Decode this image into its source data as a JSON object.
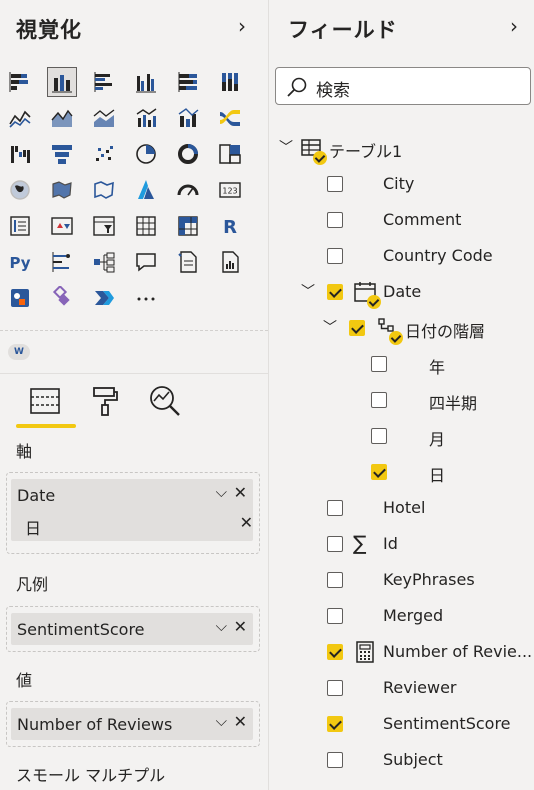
{
  "viz_pane": {
    "title": "視覚化",
    "gallery": [
      "stacked-bar-icon",
      "stacked-column-icon",
      "clustered-bar-icon",
      "clustered-column-icon",
      "100-stacked-bar-icon",
      "100-stacked-column-icon",
      "line-chart-icon",
      "area-chart-icon",
      "stacked-area-icon",
      "line-clustered-column-icon",
      "line-stacked-column-icon",
      "ribbon-chart-icon",
      "waterfall-icon",
      "funnel-icon",
      "scatter-icon",
      "pie-chart-icon",
      "donut-chart-icon",
      "treemap-icon",
      "map-icon",
      "filled-map-icon",
      "shape-map-icon",
      "azure-map-icon",
      "gauge-icon",
      "card-icon",
      "multi-row-card-icon",
      "kpi-icon",
      "slicer-icon",
      "table-icon",
      "matrix-icon",
      "r-visual-icon",
      "python-visual-icon",
      "key-influencers-icon",
      "decomposition-tree-icon",
      "qa-icon",
      "smart-narrative-icon",
      "paginated-report-icon",
      "power-apps-icon",
      "custom-visual-icon",
      "power-automate-icon",
      "more-visuals-icon"
    ],
    "selected_visual": "stacked-column-icon",
    "custom_badge": "W",
    "tabs": [
      "fields-tab-icon",
      "format-tab-icon",
      "analytics-tab-icon"
    ],
    "wells": {
      "axis_label": "軸",
      "axis_field": "Date",
      "axis_sub": "日",
      "legend_label": "凡例",
      "legend_field": "SentimentScore",
      "values_label": "値",
      "values_field": "Number of Reviews",
      "small_multiples_label": "スモール マルチプル"
    },
    "chevron": "›",
    "remove_glyph": "✕",
    "dropdown_glyph": "⌵"
  },
  "fields_pane": {
    "title": "フィールド",
    "search_placeholder": "検索",
    "table_name": "テーブル1",
    "date_field": "Date",
    "hierarchy_name": "日付の階層",
    "hierarchy_levels": [
      {
        "label": "年",
        "checked": false
      },
      {
        "label": "四半期",
        "checked": false
      },
      {
        "label": "月",
        "checked": false
      },
      {
        "label": "日",
        "checked": true
      }
    ],
    "fields_before": [
      {
        "label": "City",
        "checked": false
      },
      {
        "label": "Comment",
        "checked": false
      },
      {
        "label": "Country Code",
        "checked": false
      }
    ],
    "fields_after": [
      {
        "label": "Hotel",
        "checked": false,
        "icon": ""
      },
      {
        "label": "Id",
        "checked": false,
        "icon": "sigma-icon"
      },
      {
        "label": "KeyPhrases",
        "checked": false,
        "icon": ""
      },
      {
        "label": "Merged",
        "checked": false,
        "icon": ""
      },
      {
        "label": "Number of Revie...",
        "checked": true,
        "icon": "calculator-icon"
      },
      {
        "label": "Reviewer",
        "checked": false,
        "icon": ""
      },
      {
        "label": "SentimentScore",
        "checked": true,
        "icon": ""
      },
      {
        "label": "Subject",
        "checked": false,
        "icon": ""
      }
    ]
  },
  "colors": {
    "accent": "#f2c811",
    "background": "#f3f2f1",
    "text": "#252423"
  }
}
